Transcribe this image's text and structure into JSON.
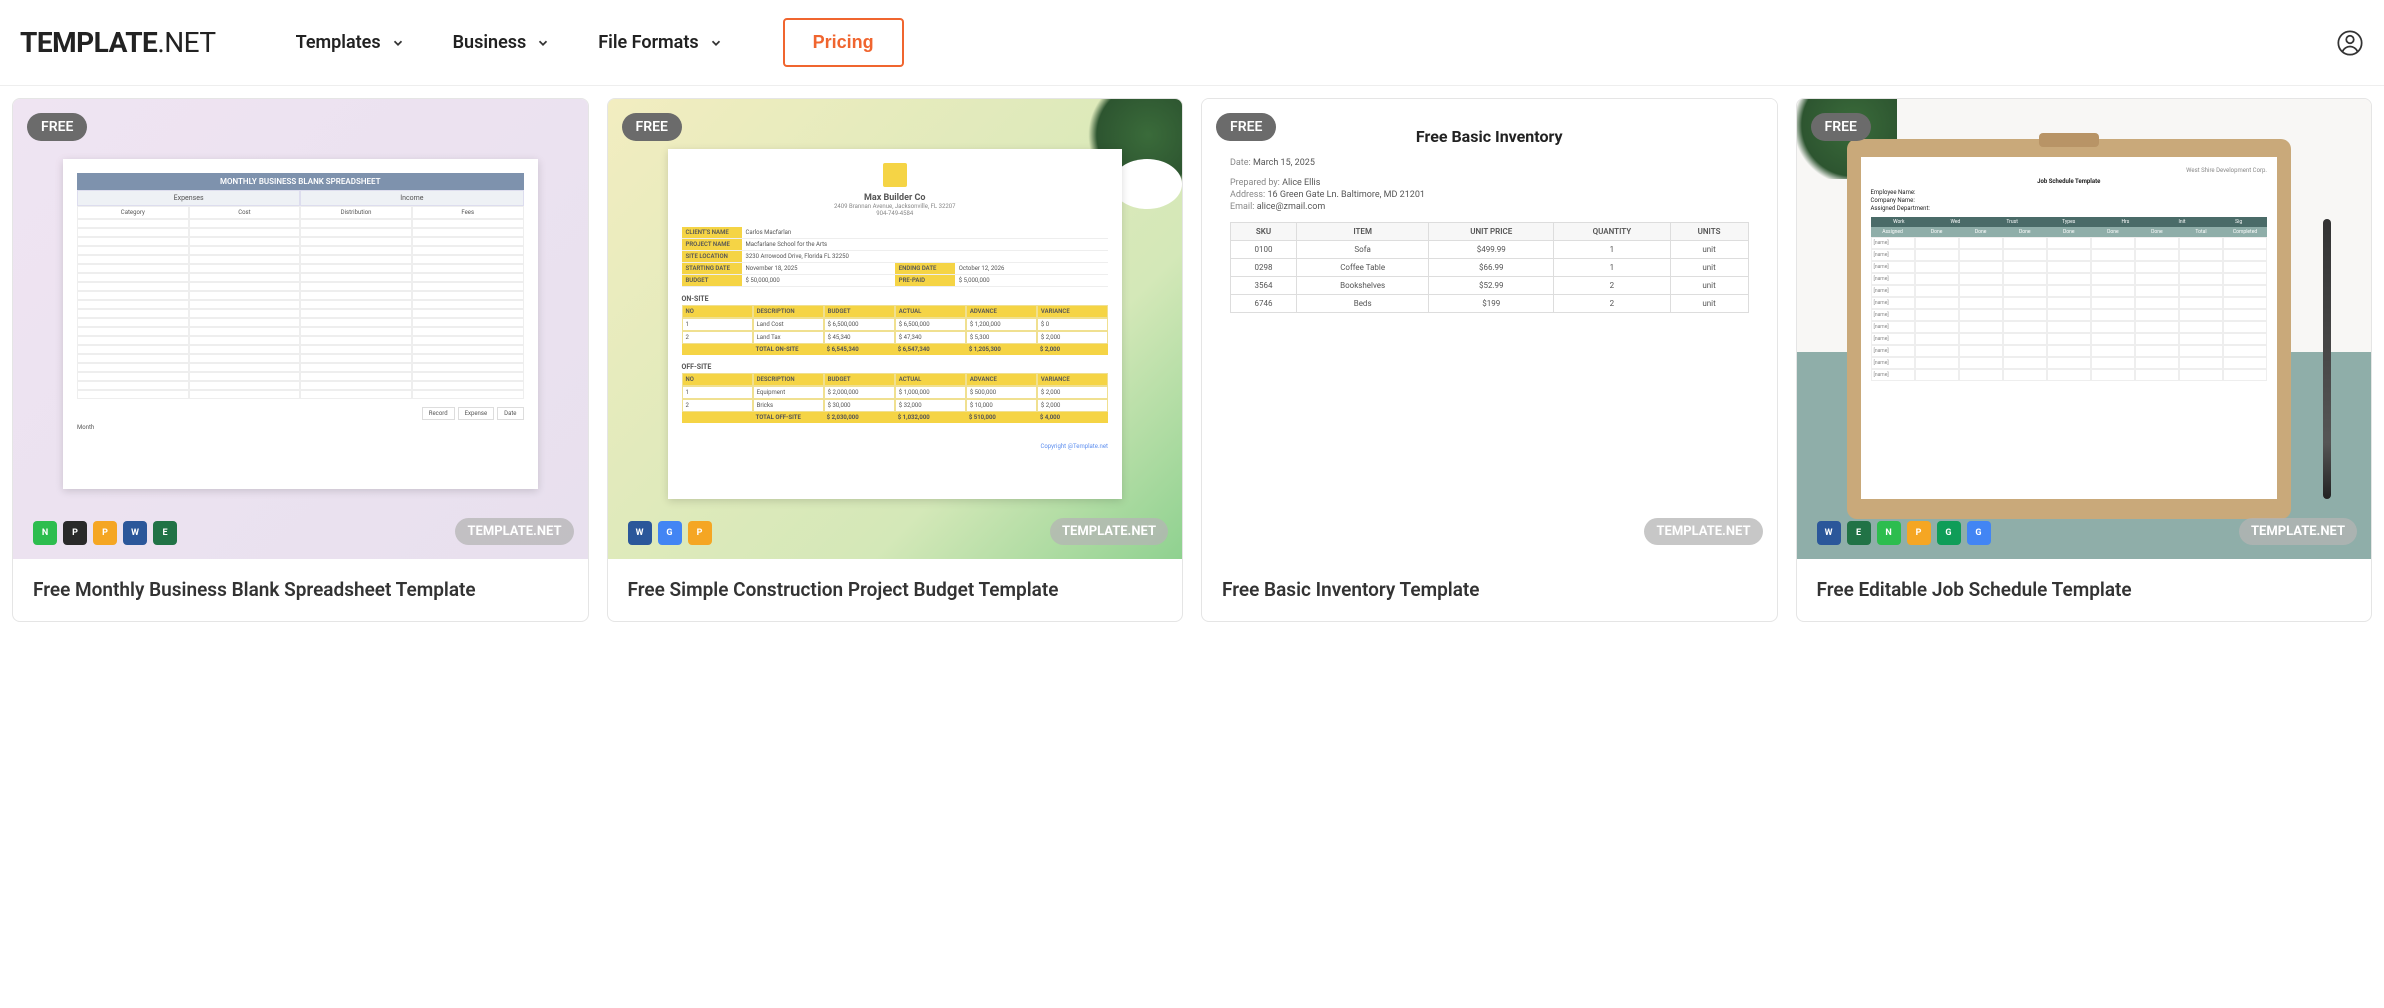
{
  "header": {
    "logo_main": "TEMPLATE",
    "logo_suffix": ".NET",
    "nav": [
      {
        "label": "Templates"
      },
      {
        "label": "Business"
      },
      {
        "label": "File Formats"
      }
    ],
    "pricing": "Pricing"
  },
  "badge_free": "FREE",
  "watermark": "TEMPLATE.NET",
  "cards": [
    {
      "title": "Free Monthly Business Blank Spreadsheet Template",
      "formats": [
        "numbers",
        "pdf",
        "pages",
        "word",
        "excel"
      ],
      "preview": {
        "heading": "MONTHLY BUSINESS BLANK SPREADSHEET",
        "sections": [
          "Expenses",
          "Income"
        ],
        "columns": [
          "Category",
          "Cost",
          "Distribution",
          "Fees"
        ],
        "footer": [
          "Record",
          "Expense",
          "Date"
        ],
        "month_label": "Month"
      }
    },
    {
      "title": "Free Simple Construction Project Budget Template",
      "formats": [
        "word",
        "gdocs",
        "pages"
      ],
      "preview": {
        "company": "Max Builder Co",
        "address": "2409 Brannan Avenue, Jacksonville, FL 32207",
        "phone": "904-749-4584",
        "info": [
          {
            "label": "CLIENT'S NAME",
            "value": "Carlos Macfarlan"
          },
          {
            "label": "PROJECT NAME",
            "value": "Macfarlane School for the Arts"
          },
          {
            "label": "SITE LOCATION",
            "value": "3230 Arrowood Drive, Florida FL 32250"
          },
          {
            "label": "STARTING DATE",
            "value": "November 18, 2025",
            "label2": "ENDING DATE",
            "value2": "October 12, 2026"
          },
          {
            "label": "BUDGET",
            "value": "$ 50,000,000",
            "label2": "PRE-PAID",
            "value2": "$ 5,000,000"
          }
        ],
        "table_headers": [
          "NO",
          "DESCRIPTION",
          "BUDGET",
          "ACTUAL",
          "ADVANCE",
          "VARIANCE"
        ],
        "onsite_label": "ON-SITE",
        "onsite": [
          {
            "no": "1",
            "desc": "Land Cost",
            "budget": "$ 6,500,000",
            "actual": "$ 6,500,000",
            "advance": "$ 1,200,000",
            "variance": "$ 0"
          },
          {
            "no": "2",
            "desc": "Land Tax",
            "budget": "$ 45,340",
            "actual": "$ 47,340",
            "advance": "$ 5,300",
            "variance": "$ 2,000"
          }
        ],
        "onsite_total": {
          "label": "TOTAL ON-SITE",
          "budget": "$ 6,545,340",
          "actual": "$ 6,547,340",
          "advance": "$ 1,205,300",
          "variance": "$ 2,000"
        },
        "offsite_label": "OFF-SITE",
        "offsite": [
          {
            "no": "1",
            "desc": "Equipment",
            "budget": "$ 2,000,000",
            "actual": "$ 1,000,000",
            "advance": "$ 500,000",
            "variance": "$ 2,000"
          },
          {
            "no": "2",
            "desc": "Bricks",
            "budget": "$ 30,000",
            "actual": "$ 32,000",
            "advance": "$ 10,000",
            "variance": "$ 2,000"
          }
        ],
        "offsite_total": {
          "label": "TOTAL OFF-SITE",
          "budget": "$ 2,030,000",
          "actual": "$ 1,032,000",
          "advance": "$ 510,000",
          "variance": "$ 4,000"
        },
        "copyright": "Copyright @Template.net"
      }
    },
    {
      "title": "Free Basic Inventory Template",
      "formats": [],
      "preview": {
        "heading": "Free Basic Inventory",
        "date_label": "Date:",
        "date": "March 15, 2025",
        "prepared_label": "Prepared by:",
        "prepared": "Alice Ellis",
        "address_label": "Address:",
        "address": "16 Green Gate Ln. Baltimore, MD 21201",
        "email_label": "Email:",
        "email": "alice@zmail.com",
        "columns": [
          "SKU",
          "ITEM",
          "UNIT PRICE",
          "QUANTITY",
          "UNITS"
        ],
        "rows": [
          {
            "sku": "0100",
            "item": "Sofa",
            "price": "$499.99",
            "qty": "1",
            "units": "unit"
          },
          {
            "sku": "0298",
            "item": "Coffee Table",
            "price": "$66.99",
            "qty": "1",
            "units": "unit"
          },
          {
            "sku": "3564",
            "item": "Bookshelves",
            "price": "$52.99",
            "qty": "2",
            "units": "unit"
          },
          {
            "sku": "6746",
            "item": "Beds",
            "price": "$199",
            "qty": "2",
            "units": "unit"
          }
        ]
      }
    },
    {
      "title": "Free Editable Job Schedule Template",
      "formats": [
        "word",
        "excel",
        "numbers",
        "pages",
        "gsheets",
        "gdocs"
      ],
      "preview": {
        "corp": "West Shire Development Corp.",
        "heading": "Job Schedule Template",
        "meta": [
          "Employee Name:",
          "Company Name:",
          "Assigned Department:"
        ],
        "head1": [
          "Work",
          "Wed",
          "Trust",
          "Types",
          "Hrs",
          "Init",
          "Sig"
        ],
        "head2": [
          "Assigned",
          "Done",
          "Done",
          "Done",
          "Done",
          "Done",
          "Done",
          "Total",
          "Completed"
        ],
        "row_label": "[name]"
      }
    }
  ],
  "format_colors": {
    "numbers": "#2dbd4e",
    "pdf": "#2a2a2a",
    "pages": "#f5a623",
    "word": "#2b579a",
    "excel": "#217346",
    "gdocs": "#4285f4",
    "gsheets": "#0f9d58"
  }
}
